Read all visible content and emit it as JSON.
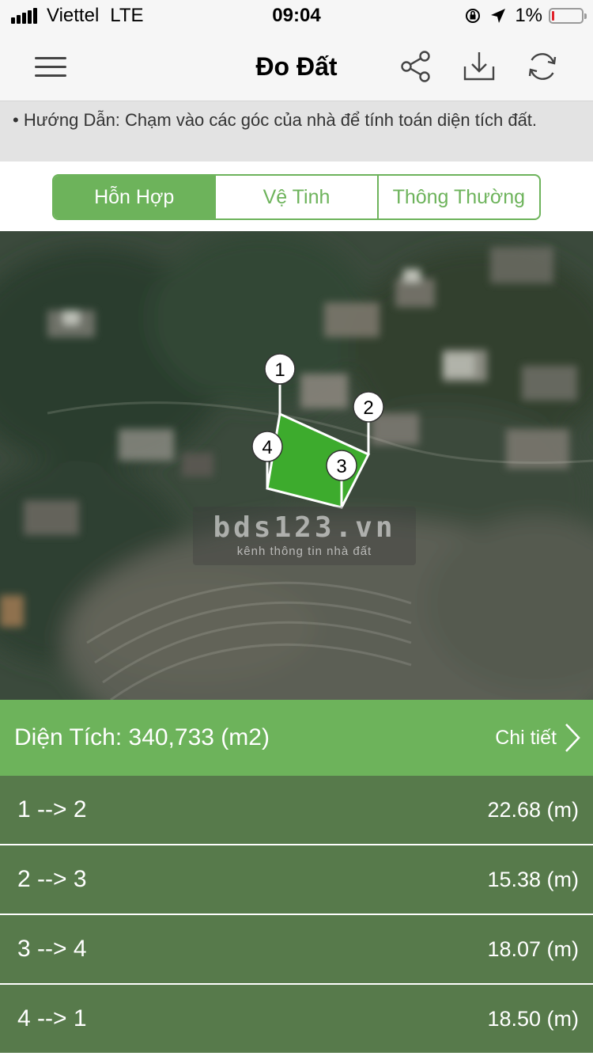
{
  "status_bar": {
    "carrier": "Viettel",
    "network": "LTE",
    "time": "09:04",
    "battery": "1%"
  },
  "header": {
    "title": "Đo Đất",
    "icons": [
      "menu-icon",
      "share-icon",
      "download-icon",
      "refresh-icon"
    ]
  },
  "hint": "• Hướng Dẫn: Chạm vào các góc của nhà để tính toán diện tích đất.",
  "map_types": {
    "options": [
      "Hỗn Hợp",
      "Vệ Tinh",
      "Thông Thường"
    ],
    "selected": "Hỗn Hợp"
  },
  "map": {
    "markers": [
      "1",
      "2",
      "3",
      "4"
    ],
    "polygon_color": "#3dab2d",
    "watermark_title": "bds123.vn",
    "watermark_subtitle": "kênh thông tin nhà đất"
  },
  "area": {
    "text": "Diện Tích: 340,733 (m2)",
    "detail_label": "Chi tiết"
  },
  "distances": [
    {
      "label": "1 --> 2",
      "value": "22.68 (m)"
    },
    {
      "label": "2 --> 3",
      "value": "15.38 (m)"
    },
    {
      "label": "3 --> 4",
      "value": "18.07 (m)"
    },
    {
      "label": "4 --> 1",
      "value": "18.50 (m)"
    }
  ],
  "colors": {
    "accent": "#6db35b",
    "list_background": "#577a4b",
    "battery_low": "#e0232b"
  }
}
